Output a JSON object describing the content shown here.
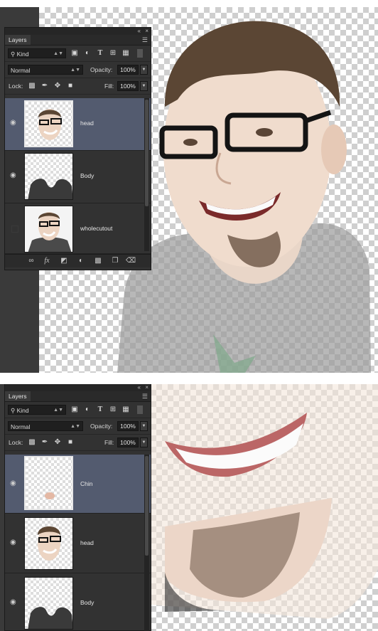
{
  "screens": [
    {
      "panel": {
        "tab": "Layers",
        "filter_kind": "Kind",
        "blend_mode": "Normal",
        "opacity_label": "Opacity:",
        "opacity_value": "100%",
        "lock_label": "Lock:",
        "fill_label": "Fill:",
        "fill_value": "100%",
        "layers": [
          {
            "name": "head",
            "selected": true,
            "visible": true
          },
          {
            "name": "Body",
            "selected": false,
            "visible": true
          },
          {
            "name": "wholecutout",
            "selected": false,
            "visible": false
          }
        ]
      }
    },
    {
      "panel": {
        "tab": "Layers",
        "filter_kind": "Kind",
        "blend_mode": "Normal",
        "opacity_label": "Opacity:",
        "opacity_value": "100%",
        "lock_label": "Lock:",
        "fill_label": "Fill:",
        "fill_value": "100%",
        "layers": [
          {
            "name": "Chin",
            "selected": true,
            "visible": true
          },
          {
            "name": "head",
            "selected": false,
            "visible": true
          },
          {
            "name": "Body",
            "selected": false,
            "visible": true
          }
        ]
      }
    }
  ],
  "icons": {
    "collapse": "double-chevron-icon",
    "close": "close-icon",
    "panel_menu": "panel-menu-icon",
    "search": "search-icon",
    "filter_pixel": "image-filter-icon",
    "filter_adjustment": "adjustment-filter-icon",
    "filter_type": "type-filter-icon",
    "filter_shape": "shape-filter-icon",
    "filter_smart": "smart-object-filter-icon",
    "eye": "eye-icon",
    "link": "link-icon",
    "fx": "fx-icon",
    "mask": "mask-icon",
    "adjust": "adjustment-layer-icon",
    "folder": "folder-icon",
    "new": "new-layer-icon",
    "trash": "trash-icon"
  },
  "colors": {
    "panel_bg": "#323232",
    "selected_layer": "#535b6f",
    "checker": "#cfcfcf"
  }
}
